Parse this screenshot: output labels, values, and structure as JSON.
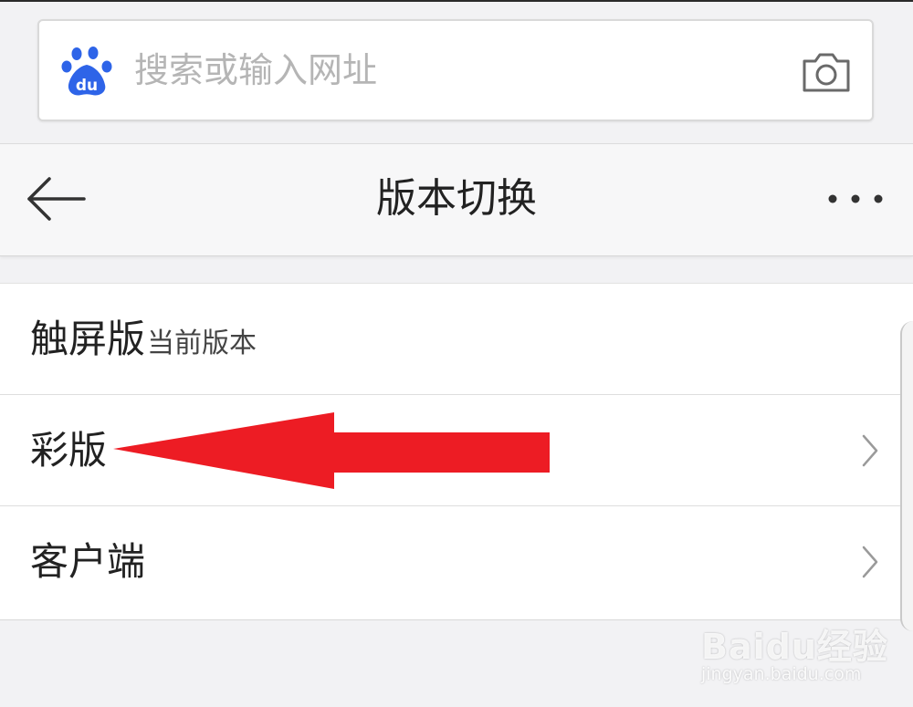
{
  "search": {
    "placeholder": "搜索或输入网址",
    "logo_icon": "baidu-paw-icon",
    "camera_icon": "camera-icon"
  },
  "header": {
    "title": "版本切换",
    "back_icon": "arrow-left-icon",
    "more_icon": "more-horizontal-icon"
  },
  "list": {
    "items": [
      {
        "label": "触屏版",
        "sublabel": "当前版本",
        "chevron": false
      },
      {
        "label": "彩版",
        "sublabel": "",
        "chevron": true
      },
      {
        "label": "客户端",
        "sublabel": "",
        "chevron": true
      }
    ]
  },
  "annotation": {
    "icon": "red-arrow-icon",
    "color": "#ed1c24"
  },
  "watermark": {
    "brand": "Baidu经验",
    "url": "jingyan.baidu.com"
  },
  "colors": {
    "baidu_blue": "#2e64e8",
    "background": "#f2f2f4"
  }
}
